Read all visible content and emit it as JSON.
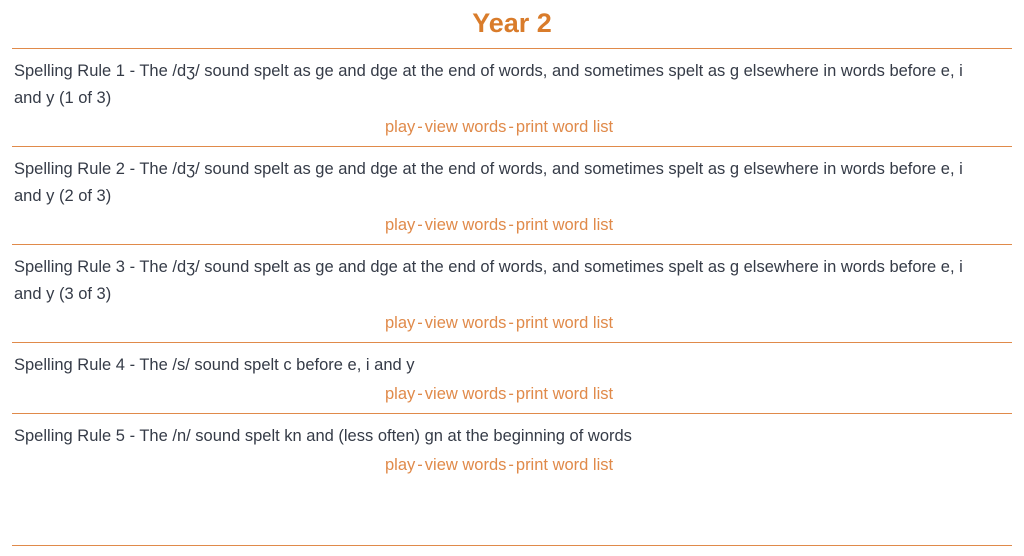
{
  "header": {
    "title": "Year 2"
  },
  "colors": {
    "accent": "#d97c2b",
    "link": "#e08a4a",
    "divider": "#e08a4a",
    "text": "#353b47",
    "background": "#ffffff"
  },
  "links": {
    "play": "play",
    "view_words": "view words",
    "print_word_list": "print word list",
    "separator": "-"
  },
  "rules": [
    {
      "text": "Spelling Rule 1 - The /dʒ/ sound spelt as ge and dge at the end of words, and sometimes spelt as g elsewhere in words before e, i and y (1 of 3)"
    },
    {
      "text": "Spelling Rule 2 - The /dʒ/ sound spelt as ge and dge at the end of words, and sometimes spelt as g elsewhere in words before e, i and y (2 of 3)"
    },
    {
      "text": "Spelling Rule 3 - The /dʒ/ sound spelt as ge and dge at the end of words, and sometimes spelt as g elsewhere in words before e, i and y (3 of 3)"
    },
    {
      "text": "Spelling Rule 4 - The /s/ sound spelt c before e, i and y"
    },
    {
      "text": "Spelling Rule 5 - The /n/ sound spelt kn and (less often) gn at the beginning of words"
    }
  ]
}
